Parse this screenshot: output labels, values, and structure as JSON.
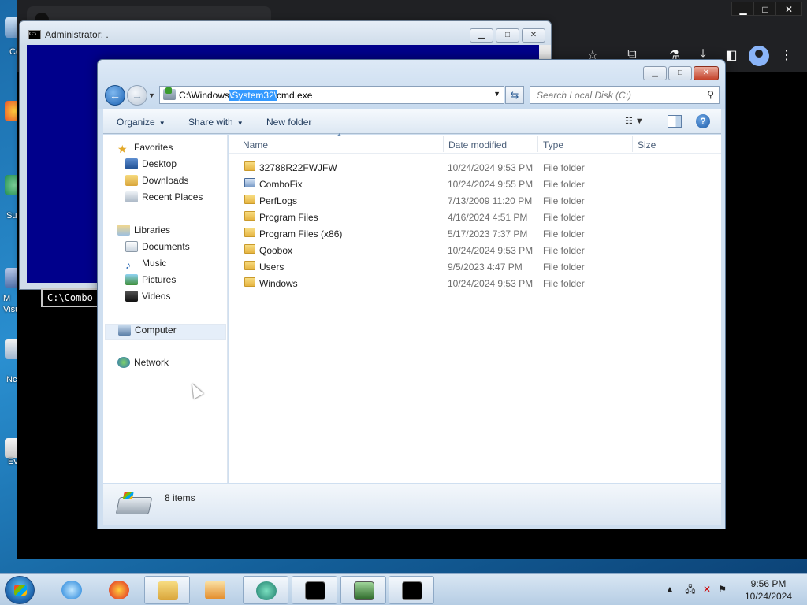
{
  "desktop": {
    "labels": [
      "Co",
      "Su",
      "M Visu",
      "Nc",
      "Ev"
    ]
  },
  "chrome": {
    "controls": {
      "minimize": "▁",
      "maximize": "□",
      "close": "✕"
    }
  },
  "cmd_window": {
    "title": "Administrator: .",
    "prompt_text": "C:\\Combo"
  },
  "explorer": {
    "address": {
      "prefix": "C:\\Windows",
      "selected": "\\System32\\",
      "suffix": "cmd.exe"
    },
    "search_placeholder": "Search Local Disk (C:)",
    "toolbar": {
      "organize": "Organize",
      "share_with": "Share with",
      "new_folder": "New folder"
    },
    "nav": {
      "favorites": "Favorites",
      "desktop": "Desktop",
      "downloads": "Downloads",
      "recent_places": "Recent Places",
      "libraries": "Libraries",
      "documents": "Documents",
      "music": "Music",
      "pictures": "Pictures",
      "videos": "Videos",
      "computer": "Computer",
      "network": "Network"
    },
    "columns": {
      "name": "Name",
      "date_modified": "Date modified",
      "type": "Type",
      "size": "Size"
    },
    "rows": [
      {
        "name": "32788R22FWJFW",
        "date": "10/24/2024 9:53 PM",
        "type": "File folder"
      },
      {
        "name": "ComboFix",
        "date": "10/24/2024 9:55 PM",
        "type": "File folder"
      },
      {
        "name": "PerfLogs",
        "date": "7/13/2009 11:20 PM",
        "type": "File folder"
      },
      {
        "name": "Program Files",
        "date": "4/16/2024 4:51 PM",
        "type": "File folder"
      },
      {
        "name": "Program Files (x86)",
        "date": "5/17/2023 7:37 PM",
        "type": "File folder"
      },
      {
        "name": "Qoobox",
        "date": "10/24/2024 9:53 PM",
        "type": "File folder"
      },
      {
        "name": "Users",
        "date": "9/5/2023 4:47 PM",
        "type": "File folder"
      },
      {
        "name": "Windows",
        "date": "10/24/2024 9:53 PM",
        "type": "File folder"
      }
    ],
    "status_count": "8 items"
  },
  "taskbar": {
    "time": "9:56 PM",
    "date": "10/24/2024"
  },
  "colors": {
    "cmd_background": "#00008b",
    "selection": "#3399ff",
    "folder": "#e6b441"
  }
}
